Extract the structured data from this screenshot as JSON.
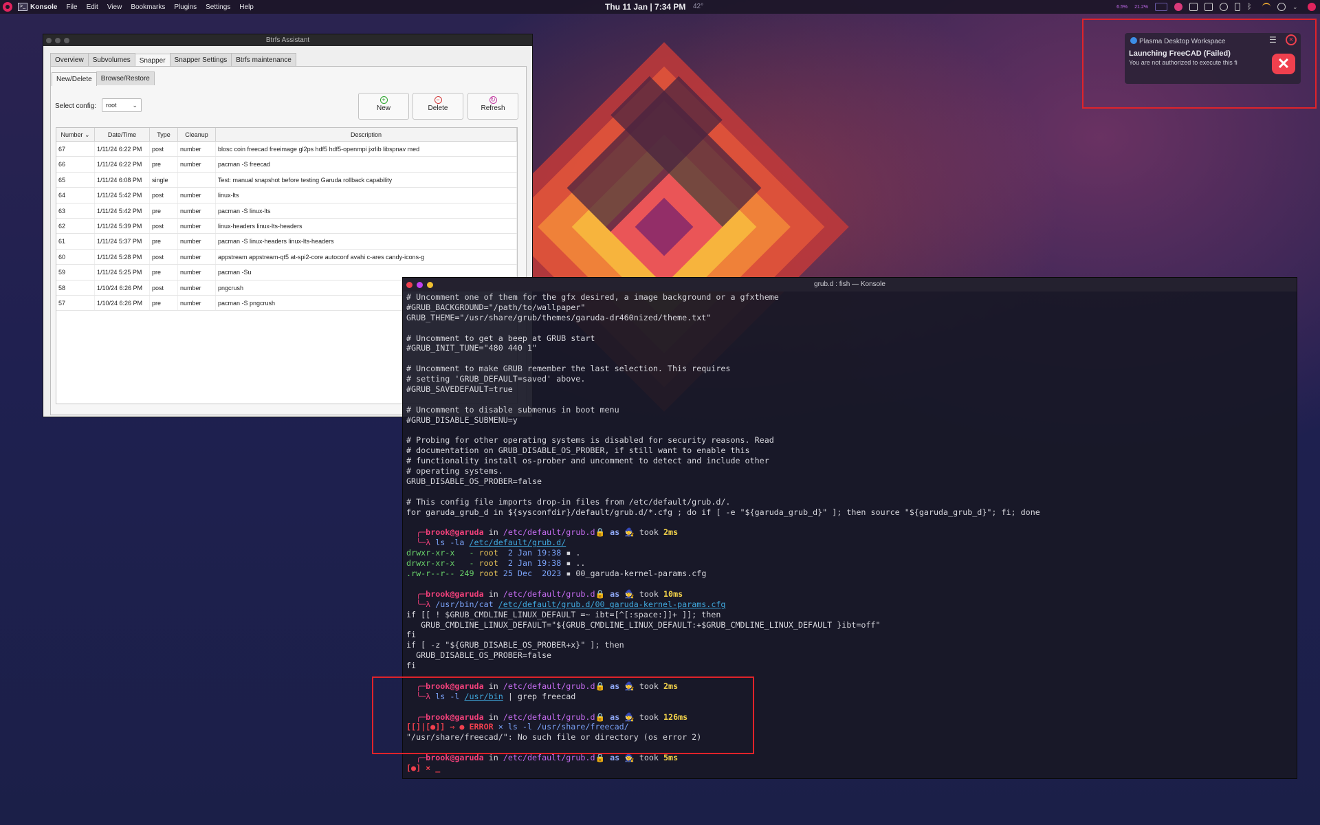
{
  "topbar": {
    "app_name": "Konsole",
    "menus": [
      "File",
      "Edit",
      "View",
      "Bookmarks",
      "Plugins",
      "Settings",
      "Help"
    ],
    "clock": "Thu 11 Jan | 7:34 PM",
    "weather": "42°",
    "tray_cpu": "6.5%",
    "tray_mem": "21.2%"
  },
  "notification": {
    "app": "Plasma Desktop Workspace",
    "title": "Launching FreeCAD (Failed)",
    "body": "You are not authorized to execute this fi"
  },
  "btrfs": {
    "title": "Btrfs Assistant",
    "tabs": [
      "Overview",
      "Subvolumes",
      "Snapper",
      "Snapper Settings",
      "Btrfs maintenance"
    ],
    "subtabs": [
      "New/Delete",
      "Browse/Restore"
    ],
    "select_config_label": "Select config:",
    "select_config_value": "root",
    "buttons": {
      "new": "New",
      "delete": "Delete",
      "refresh": "Refresh"
    },
    "columns": [
      "Number",
      "Date/Time",
      "Type",
      "Cleanup",
      "Description"
    ],
    "rows": [
      {
        "number": "67",
        "date": "1/11/24 6:22 PM",
        "type": "post",
        "cleanup": "number",
        "desc": "blosc coin freecad freeimage gl2ps hdf5 hdf5-openmpi jxrlib libspnav med"
      },
      {
        "number": "66",
        "date": "1/11/24 6:22 PM",
        "type": "pre",
        "cleanup": "number",
        "desc": "pacman -S freecad"
      },
      {
        "number": "65",
        "date": "1/11/24 6:08 PM",
        "type": "single",
        "cleanup": "",
        "desc": "Test: manual snapshot before testing Garuda rollback capability"
      },
      {
        "number": "64",
        "date": "1/11/24 5:42 PM",
        "type": "post",
        "cleanup": "number",
        "desc": "linux-lts"
      },
      {
        "number": "63",
        "date": "1/11/24 5:42 PM",
        "type": "pre",
        "cleanup": "number",
        "desc": "pacman -S linux-lts"
      },
      {
        "number": "62",
        "date": "1/11/24 5:39 PM",
        "type": "post",
        "cleanup": "number",
        "desc": "linux-headers linux-lts-headers"
      },
      {
        "number": "61",
        "date": "1/11/24 5:37 PM",
        "type": "pre",
        "cleanup": "number",
        "desc": "pacman -S linux-headers linux-lts-headers"
      },
      {
        "number": "60",
        "date": "1/11/24 5:28 PM",
        "type": "post",
        "cleanup": "number",
        "desc": "appstream appstream-qt5 at-spi2-core autoconf avahi c-ares candy-icons-g"
      },
      {
        "number": "59",
        "date": "1/11/24 5:25 PM",
        "type": "pre",
        "cleanup": "number",
        "desc": "pacman -Su"
      },
      {
        "number": "58",
        "date": "1/10/24 6:26 PM",
        "type": "post",
        "cleanup": "number",
        "desc": "pngcrush"
      },
      {
        "number": "57",
        "date": "1/10/24 6:26 PM",
        "type": "pre",
        "cleanup": "number",
        "desc": "pacman -S pngcrush"
      }
    ]
  },
  "konsole": {
    "title": "grub.d : fish — Konsole",
    "config_lines": [
      "# Uncomment one of them for the gfx desired, a image background or a gfxtheme",
      "#GRUB_BACKGROUND=\"/path/to/wallpaper\"",
      "GRUB_THEME=\"/usr/share/grub/themes/garuda-dr460nized/theme.txt\"",
      "",
      "# Uncomment to get a beep at GRUB start",
      "#GRUB_INIT_TUNE=\"480 440 1\"",
      "",
      "# Uncomment to make GRUB remember the last selection. This requires",
      "# setting 'GRUB_DEFAULT=saved' above.",
      "#GRUB_SAVEDEFAULT=true",
      "",
      "# Uncomment to disable submenus in boot menu",
      "#GRUB_DISABLE_SUBMENU=y",
      "",
      "# Probing for other operating systems is disabled for security reasons. Read",
      "# documentation on GRUB_DISABLE_OS_PROBER, if still want to enable this",
      "# functionality install os-prober and uncomment to detect and include other",
      "# operating systems.",
      "GRUB_DISABLE_OS_PROBER=false",
      "",
      "# This config file imports drop-in files from /etc/default/grub.d/.",
      "for garuda_grub_d in ${sysconfdir}/default/grub.d/*.cfg ; do if [ -e \"${garuda_grub_d}\" ]; then source \"${garuda_grub_d}\"; fi; done",
      ""
    ],
    "prompt": {
      "user": "brook",
      "host": "garuda",
      "in": "in",
      "path": "/etc/default/grub.d",
      "as": "as",
      "took": "took"
    },
    "p1_time": "2ms",
    "p1_cmd": "ls -la",
    "p1_arg": "/etc/default/grub.d/",
    "ls_lines": [
      {
        "perm": "drwxr-xr-x",
        "size": "  -",
        "owner": "root",
        "date": " 2 Jan 19:38",
        "name": "."
      },
      {
        "perm": "drwxr-xr-x",
        "size": "  -",
        "owner": "root",
        "date": " 2 Jan 19:38",
        "name": ".."
      },
      {
        "perm": ".rw-r--r--",
        "size": "249",
        "owner": "root",
        "date": "25 Dec  2023",
        "name": "00_garuda-kernel-params.cfg"
      }
    ],
    "p2_time": "10ms",
    "p2_cmd": "/usr/bin/cat",
    "p2_arg": "/etc/default/grub.d/00_garuda-kernel-params.cfg",
    "cat_lines": [
      "if [[ ! $GRUB_CMDLINE_LINUX_DEFAULT =~ ibt=[^[:space:]]+ ]]; then",
      "   GRUB_CMDLINE_LINUX_DEFAULT=\"${GRUB_CMDLINE_LINUX_DEFAULT:+$GRUB_CMDLINE_LINUX_DEFAULT }ibt=off\"",
      "fi",
      "if [ -z \"${GRUB_DISABLE_OS_PROBER+x}\" ]; then",
      "  GRUB_DISABLE_OS_PROBER=false",
      "fi",
      ""
    ],
    "p3_time": "2ms",
    "p3_cmd": "ls -l",
    "p3_arg": "/usr/bin",
    "p3_pipe": "| grep freecad",
    "p4_time": "126ms",
    "err_prefix": "[[]|[●]] ⇒ ● ",
    "err_label": "ERROR",
    "err_cmd": "× ls -l /usr/share/freecad/",
    "err_msg": "\"/usr/share/freecad/\": No such file or directory (os error 2)",
    "p5_time": "5ms",
    "last_prompt": "[●] × _"
  }
}
